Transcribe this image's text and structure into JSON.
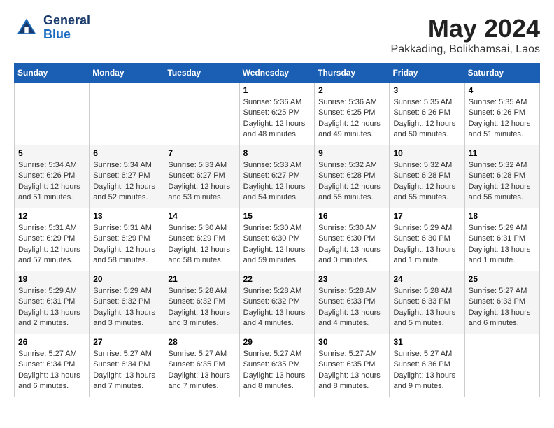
{
  "logo": {
    "line1": "General",
    "line2": "Blue"
  },
  "header": {
    "month_year": "May 2024",
    "location": "Pakkading, Bolikhamsai, Laos"
  },
  "weekdays": [
    "Sunday",
    "Monday",
    "Tuesday",
    "Wednesday",
    "Thursday",
    "Friday",
    "Saturday"
  ],
  "weeks": [
    [
      {
        "day": "",
        "info": ""
      },
      {
        "day": "",
        "info": ""
      },
      {
        "day": "",
        "info": ""
      },
      {
        "day": "1",
        "info": "Sunrise: 5:36 AM\nSunset: 6:25 PM\nDaylight: 12 hours\nand 48 minutes."
      },
      {
        "day": "2",
        "info": "Sunrise: 5:36 AM\nSunset: 6:25 PM\nDaylight: 12 hours\nand 49 minutes."
      },
      {
        "day": "3",
        "info": "Sunrise: 5:35 AM\nSunset: 6:26 PM\nDaylight: 12 hours\nand 50 minutes."
      },
      {
        "day": "4",
        "info": "Sunrise: 5:35 AM\nSunset: 6:26 PM\nDaylight: 12 hours\nand 51 minutes."
      }
    ],
    [
      {
        "day": "5",
        "info": "Sunrise: 5:34 AM\nSunset: 6:26 PM\nDaylight: 12 hours\nand 51 minutes."
      },
      {
        "day": "6",
        "info": "Sunrise: 5:34 AM\nSunset: 6:27 PM\nDaylight: 12 hours\nand 52 minutes."
      },
      {
        "day": "7",
        "info": "Sunrise: 5:33 AM\nSunset: 6:27 PM\nDaylight: 12 hours\nand 53 minutes."
      },
      {
        "day": "8",
        "info": "Sunrise: 5:33 AM\nSunset: 6:27 PM\nDaylight: 12 hours\nand 54 minutes."
      },
      {
        "day": "9",
        "info": "Sunrise: 5:32 AM\nSunset: 6:28 PM\nDaylight: 12 hours\nand 55 minutes."
      },
      {
        "day": "10",
        "info": "Sunrise: 5:32 AM\nSunset: 6:28 PM\nDaylight: 12 hours\nand 55 minutes."
      },
      {
        "day": "11",
        "info": "Sunrise: 5:32 AM\nSunset: 6:28 PM\nDaylight: 12 hours\nand 56 minutes."
      }
    ],
    [
      {
        "day": "12",
        "info": "Sunrise: 5:31 AM\nSunset: 6:29 PM\nDaylight: 12 hours\nand 57 minutes."
      },
      {
        "day": "13",
        "info": "Sunrise: 5:31 AM\nSunset: 6:29 PM\nDaylight: 12 hours\nand 58 minutes."
      },
      {
        "day": "14",
        "info": "Sunrise: 5:30 AM\nSunset: 6:29 PM\nDaylight: 12 hours\nand 58 minutes."
      },
      {
        "day": "15",
        "info": "Sunrise: 5:30 AM\nSunset: 6:30 PM\nDaylight: 12 hours\nand 59 minutes."
      },
      {
        "day": "16",
        "info": "Sunrise: 5:30 AM\nSunset: 6:30 PM\nDaylight: 13 hours\nand 0 minutes."
      },
      {
        "day": "17",
        "info": "Sunrise: 5:29 AM\nSunset: 6:30 PM\nDaylight: 13 hours\nand 1 minute."
      },
      {
        "day": "18",
        "info": "Sunrise: 5:29 AM\nSunset: 6:31 PM\nDaylight: 13 hours\nand 1 minute."
      }
    ],
    [
      {
        "day": "19",
        "info": "Sunrise: 5:29 AM\nSunset: 6:31 PM\nDaylight: 13 hours\nand 2 minutes."
      },
      {
        "day": "20",
        "info": "Sunrise: 5:29 AM\nSunset: 6:32 PM\nDaylight: 13 hours\nand 3 minutes."
      },
      {
        "day": "21",
        "info": "Sunrise: 5:28 AM\nSunset: 6:32 PM\nDaylight: 13 hours\nand 3 minutes."
      },
      {
        "day": "22",
        "info": "Sunrise: 5:28 AM\nSunset: 6:32 PM\nDaylight: 13 hours\nand 4 minutes."
      },
      {
        "day": "23",
        "info": "Sunrise: 5:28 AM\nSunset: 6:33 PM\nDaylight: 13 hours\nand 4 minutes."
      },
      {
        "day": "24",
        "info": "Sunrise: 5:28 AM\nSunset: 6:33 PM\nDaylight: 13 hours\nand 5 minutes."
      },
      {
        "day": "25",
        "info": "Sunrise: 5:27 AM\nSunset: 6:33 PM\nDaylight: 13 hours\nand 6 minutes."
      }
    ],
    [
      {
        "day": "26",
        "info": "Sunrise: 5:27 AM\nSunset: 6:34 PM\nDaylight: 13 hours\nand 6 minutes."
      },
      {
        "day": "27",
        "info": "Sunrise: 5:27 AM\nSunset: 6:34 PM\nDaylight: 13 hours\nand 7 minutes."
      },
      {
        "day": "28",
        "info": "Sunrise: 5:27 AM\nSunset: 6:35 PM\nDaylight: 13 hours\nand 7 minutes."
      },
      {
        "day": "29",
        "info": "Sunrise: 5:27 AM\nSunset: 6:35 PM\nDaylight: 13 hours\nand 8 minutes."
      },
      {
        "day": "30",
        "info": "Sunrise: 5:27 AM\nSunset: 6:35 PM\nDaylight: 13 hours\nand 8 minutes."
      },
      {
        "day": "31",
        "info": "Sunrise: 5:27 AM\nSunset: 6:36 PM\nDaylight: 13 hours\nand 9 minutes."
      },
      {
        "day": "",
        "info": ""
      }
    ]
  ]
}
